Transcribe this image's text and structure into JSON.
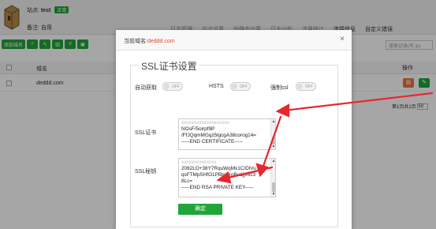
{
  "header": {
    "site_label": "站点:",
    "site_name": "test",
    "status_badge": "正常",
    "remark_label": "备注:",
    "remark_value": "自用",
    "tabs": [
      "日志管理",
      "站点设置",
      "伪静态设置",
      "日志分析",
      "流量统计",
      "连接信息",
      "自定义错误"
    ]
  },
  "toolbar": {
    "add_site": "添加域名",
    "search_placeholder": "搜索记录(名,ip)"
  },
  "table": {
    "columns": {
      "name": "域名",
      "op": "操作"
    },
    "rows": [
      {
        "name": "deddd.com"
      }
    ]
  },
  "pager": {
    "text": "第1页共1页",
    "per_page": "50"
  },
  "modal": {
    "title_prefix": "当前域名:",
    "title_domain": "deddd.com",
    "close_glyph": "×",
    "legend": "SSL证书设置",
    "options": {
      "auto_label": "自动获取",
      "hsts_label": "HSTS",
      "force_label": "强制ssl",
      "off_text": "OFF"
    },
    "cert_label": "SSL证书",
    "cert_lines": [
      "xxxxxxxxxxxxxxxxxxx",
      "NOsF/5oirpf9P",
      "/FfJQqmMGqz5lgcgA38corog14=",
      "-----END CERTIFICATE-----"
    ],
    "key_label": "SSL秘钥",
    "key_lines": [
      "xxxxxxxxxxxxxx",
      "2062LO+38Y7RquWqMx1C/DlVu",
      "qsFTMpSHfO1PBlo6koBu1jjv6c3",
      "8Lc=",
      "-----END RSA PRIVATE KEY-----"
    ],
    "confirm_label": "确定"
  },
  "colors": {
    "accent_green": "#20a53a",
    "danger_orange": "#f0703e",
    "arrow_red": "#e8272c",
    "domain_red": "#e34a2f"
  },
  "icons": [
    "logo-icon",
    "add-icon",
    "edit-icon",
    "delete-icon",
    "lock-icon",
    "close-icon",
    "delete-row-icon",
    "edit-row-icon",
    "arrow-annotation"
  ]
}
